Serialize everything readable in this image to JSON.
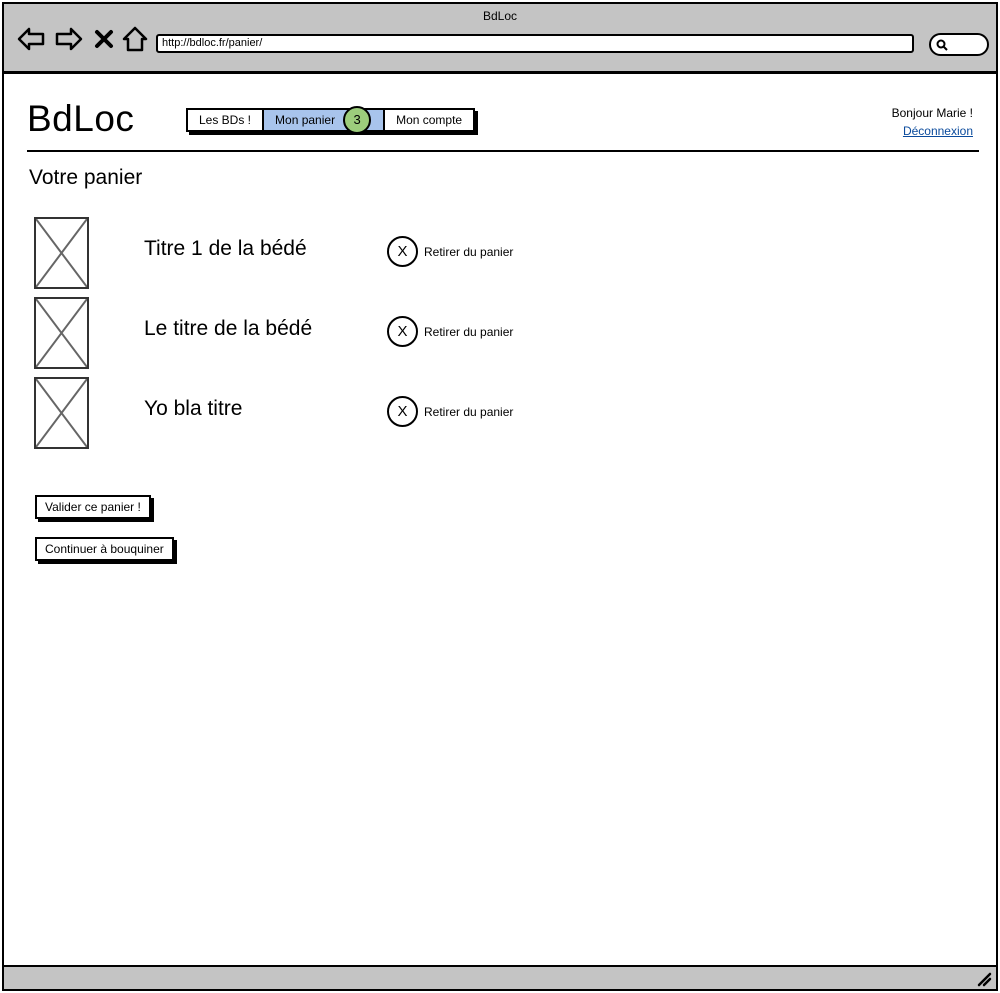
{
  "browser": {
    "window_title": "BdLoc",
    "url": "http://bdloc.fr/panier/"
  },
  "header": {
    "logo": "BdLoc",
    "nav_tabs": [
      {
        "label": "Les BDs !"
      },
      {
        "label": "Mon panier",
        "badge": "3"
      },
      {
        "label": "Mon compte"
      }
    ],
    "greeting": "Bonjour Marie !",
    "logout_label": "Déconnexion"
  },
  "main": {
    "title": "Votre panier",
    "items": [
      {
        "title": "Titre 1 de la bédé",
        "remove_icon_text": "X",
        "remove_label": "Retirer du panier"
      },
      {
        "title": "Le titre de la bédé",
        "remove_icon_text": "X",
        "remove_label": "Retirer du panier"
      },
      {
        "title": "Yo bla titre",
        "remove_icon_text": "X",
        "remove_label": "Retirer du panier"
      }
    ],
    "validate_button": "Valider ce panier !",
    "continue_button": "Continuer à bouquiner"
  },
  "colors": {
    "chrome": "#c4c4c4",
    "active_tab": "#a8c4ec",
    "badge": "#9ccd7c",
    "link": "#0a4a9c"
  },
  "icons": [
    "back-arrow-icon",
    "forward-arrow-icon",
    "stop-icon",
    "home-icon",
    "search-icon",
    "image-placeholder-icon",
    "close-icon",
    "resize-grip-icon"
  ]
}
